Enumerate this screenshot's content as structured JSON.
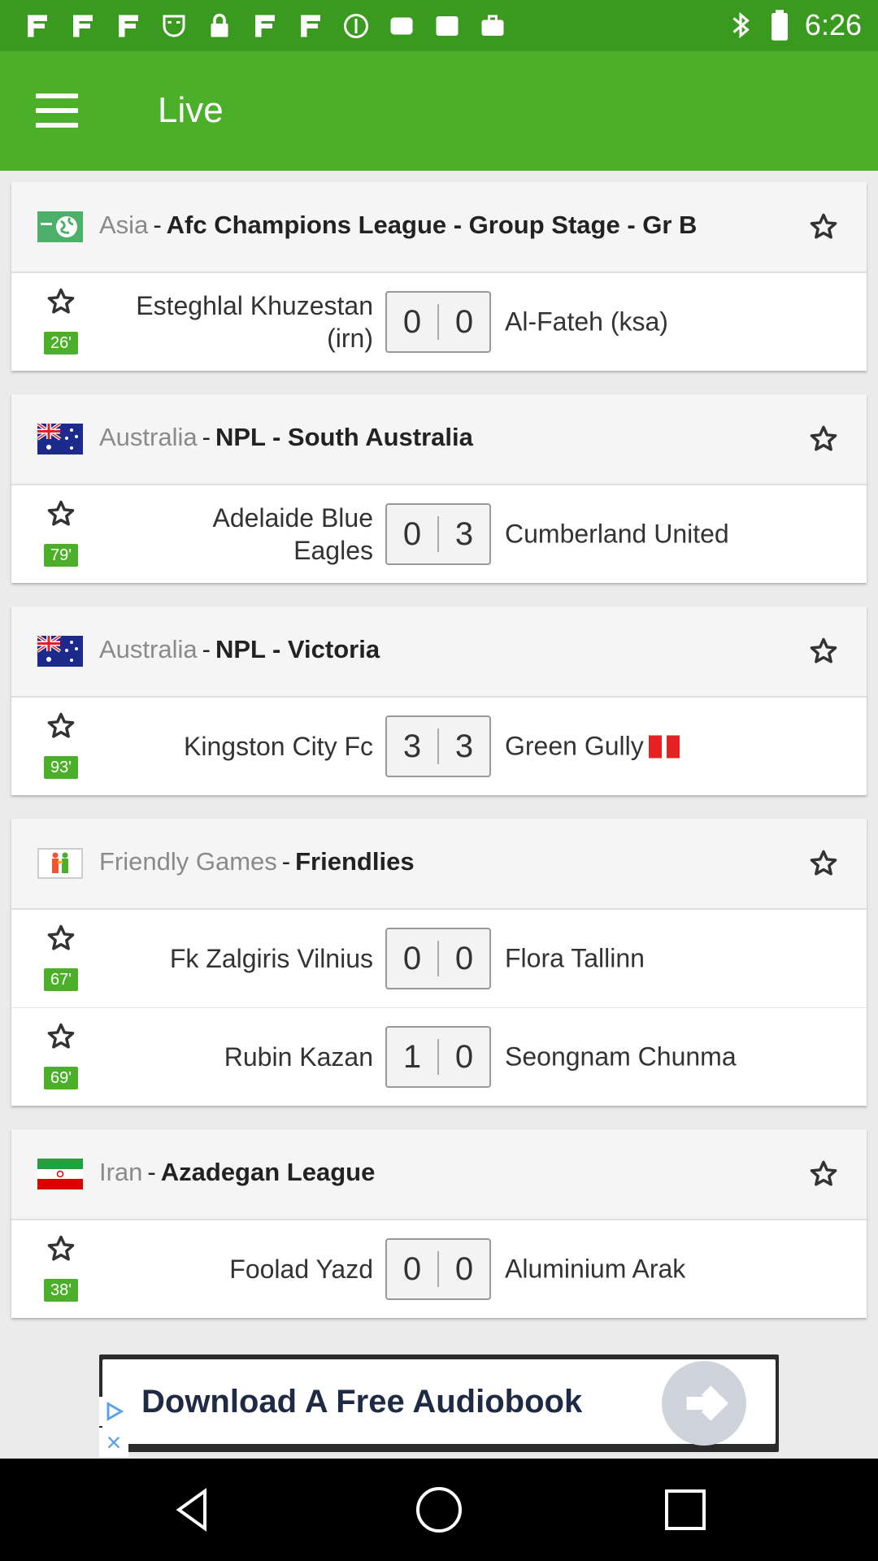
{
  "status_bar": {
    "time": "6:26",
    "icons": [
      "app-icon",
      "app-icon",
      "app-icon",
      "mask-icon",
      "lock-icon",
      "app-icon",
      "app-icon",
      "pinterest-icon",
      "photo-icon",
      "checklist-icon",
      "briefcase-icon",
      "bluetooth-icon",
      "battery-icon"
    ]
  },
  "app_bar": {
    "title": "Live",
    "menu_icon": "menu-icon"
  },
  "colors": {
    "primary": "#4caf2a",
    "status_bar": "#3a9a1f",
    "minute_badge": "#4caf2a",
    "red_card": "#e52222"
  },
  "leagues": [
    {
      "country": "Asia",
      "name": "Afc Champions League - Group Stage - Gr B",
      "flag": "world-flag",
      "matches": [
        {
          "minute": "26'",
          "home": "Esteghlal Khuzestan (irn)",
          "home_score": "0",
          "away_score": "0",
          "away": "Al-Fateh (ksa)",
          "red_cards": 0
        }
      ]
    },
    {
      "country": "Australia",
      "name": "NPL - South Australia",
      "flag": "australia-flag",
      "matches": [
        {
          "minute": "79'",
          "home": "Adelaide Blue Eagles",
          "home_score": "0",
          "away_score": "3",
          "away": "Cumberland United",
          "red_cards": 0
        }
      ]
    },
    {
      "country": "Australia",
      "name": "NPL - Victoria",
      "flag": "australia-flag",
      "matches": [
        {
          "minute": "93'",
          "home": "Kingston City Fc",
          "home_score": "3",
          "away_score": "3",
          "away": "Green Gully",
          "red_cards": 2
        }
      ]
    },
    {
      "country": "Friendly Games",
      "name": "Friendlies",
      "flag": "friendly-flag",
      "matches": [
        {
          "minute": "67'",
          "home": "Fk Zalgiris Vilnius",
          "home_score": "0",
          "away_score": "0",
          "away": "Flora Tallinn",
          "red_cards": 0
        },
        {
          "minute": "69'",
          "home": "Rubin Kazan",
          "home_score": "1",
          "away_score": "0",
          "away": "Seongnam Chunma",
          "red_cards": 0
        }
      ]
    },
    {
      "country": "Iran",
      "name": "Azadegan League",
      "flag": "iran-flag",
      "matches": [
        {
          "minute": "38'",
          "home": "Foolad Yazd",
          "home_score": "0",
          "away_score": "0",
          "away": "Aluminium Arak",
          "red_cards": 0
        }
      ]
    }
  ],
  "ad": {
    "text": "Download A Free Audiobook"
  },
  "nav_bar": {
    "buttons": [
      "back-icon",
      "home-icon",
      "recents-icon"
    ]
  }
}
